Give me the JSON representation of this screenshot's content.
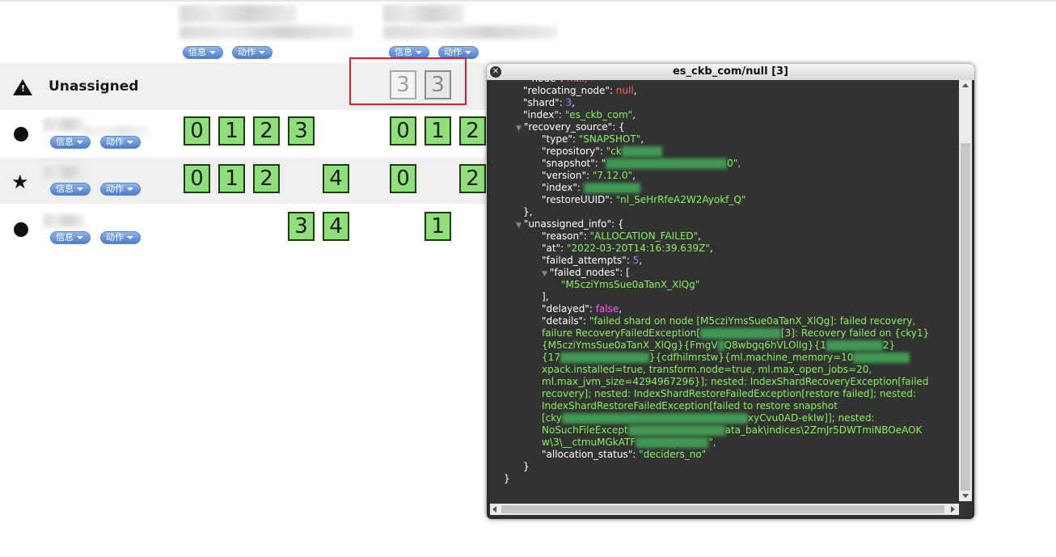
{
  "buttons": {
    "info": "信息",
    "action": "动作"
  },
  "unassigned": {
    "label": "Unassigned",
    "shards": [
      "3",
      "3"
    ]
  },
  "nodes": [
    {
      "shards_a": [
        "0",
        "1",
        "2",
        "3"
      ],
      "shards_b": [
        "0",
        "1",
        "2"
      ]
    },
    {
      "shards_a": [
        "0",
        "1",
        "2",
        "4"
      ],
      "shards_b": [
        "0",
        "2"
      ]
    },
    {
      "shards_a": [
        "3",
        "4"
      ],
      "shards_b": [
        "1"
      ]
    }
  ],
  "dialog": {
    "title": "es_ckb_com/null [3]",
    "lines": {
      "l0": "\"node\": null,",
      "relocating_key": "\"relocating_node\"",
      "relocating_val": "null",
      "shard_key": "\"shard\"",
      "shard_val": "3",
      "index_key": "\"index\"",
      "index_val": "\"es_ckb_com\"",
      "recovery_key": "\"recovery_source\"",
      "type_key": "\"type\"",
      "type_val": "\"SNAPSHOT\"",
      "repository_key": "\"repository\"",
      "repository_val": "\"ck",
      "snapshot_key": "\"snapshot\"",
      "snapshot_val": "0\",",
      "version_key": "\"version\"",
      "version_val": "\"7.12.0\"",
      "index2_key": "\"index\"",
      "restore_key": "\"restoreUUID\"",
      "restore_val": "\"nl_SeHrRfeA2W2Ayokf_Q\"",
      "close1": "},",
      "unassigned_key": "\"unassigned_info\"",
      "reason_key": "\"reason\"",
      "reason_val": "\"ALLOCATION_FAILED\"",
      "at_key": "\"at\"",
      "at_val": "\"2022-03-20T14:16:39.639Z\"",
      "failed_attempts_key": "\"failed_attempts\"",
      "failed_attempts_val": "5",
      "failed_nodes_key": "\"failed_nodes\"",
      "failed_nodes_val": "\"M5cziYmsSue0aTanX_XlQg\"",
      "close2": "],",
      "delayed_key": "\"delayed\"",
      "delayed_val": "false",
      "details_key": "\"details\"",
      "d1": "\"failed shard on node [M5cziYmsSue0aTanX_XlQg]: failed recovery,",
      "d2a": "failure RecoveryFailedException[",
      "d2b": "[3]: Recovery failed on {cky1}",
      "d3a": "{M5cziYmsSue0aTanX_XlQg}{FmgV",
      "d3b": "Q8wbgq6hVLOlIg}{1",
      "d3c": "2}",
      "d4a": "{17",
      "d4b": "}{cdfhilmrstw}{ml.machine_memory=10",
      "d5": "xpack.installed=true, transform.node=true, ml.max_open_jobs=20,",
      "d6": "ml.max_jvm_size=4294967296}]; nested: IndexShardRecoveryException[failed",
      "d7": "recovery]; nested: IndexShardRestoreFailedException[restore failed]; nested:",
      "d8": "IndexShardRestoreFailedException[failed to restore snapshot",
      "d9a": "[cky",
      "d9b": "xyCvu0AD-ekIw]]; nested:",
      "d10a": "NoSuchFileExcept",
      "d10b": "ata_bak\\indices\\2ZmJr5DWTmiNBOeAOK",
      "d11a": "w\\3\\__ctmuMGkATF",
      "d11b": "\",",
      "alloc_key": "\"allocation_status\"",
      "alloc_val": "\"deciders_no\"",
      "close3": "}",
      "close4": "}"
    }
  }
}
